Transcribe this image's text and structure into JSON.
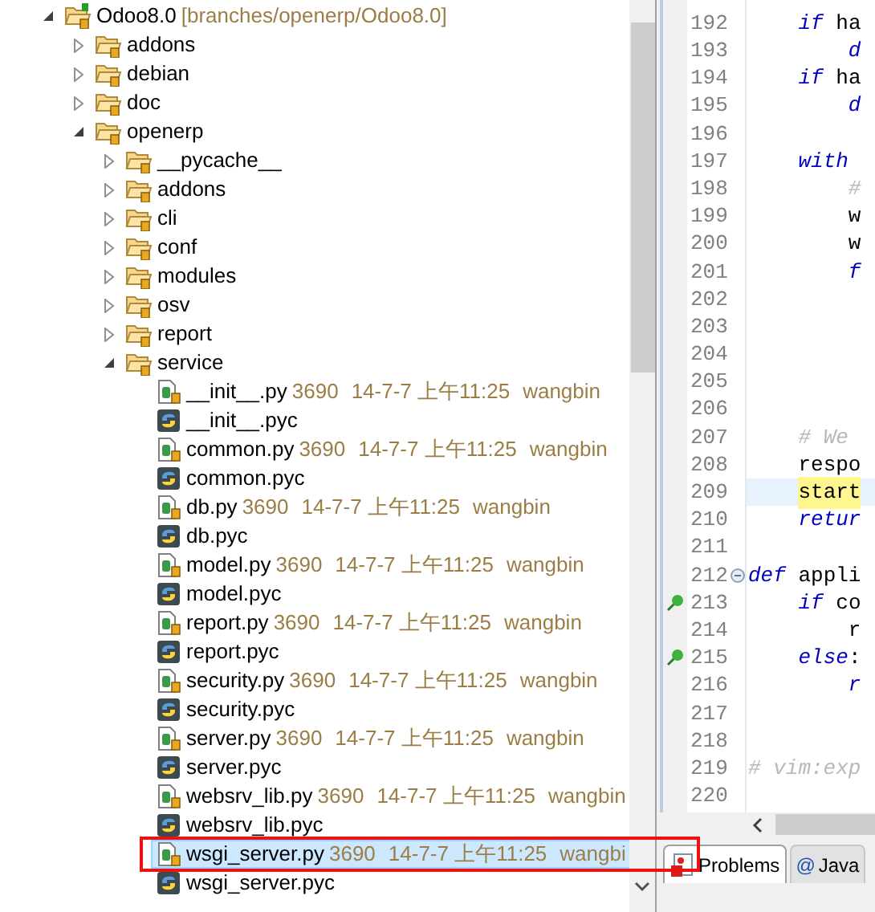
{
  "tree": {
    "name": "Odoo8.0",
    "decoration": "[branches/openerp/Odoo8.0]",
    "kind": "project",
    "expanded": true,
    "selected": false,
    "children": [
      {
        "kind": "folder",
        "name": "addons",
        "expanded": false,
        "selected": false
      },
      {
        "kind": "folder",
        "name": "debian",
        "expanded": false,
        "selected": false
      },
      {
        "kind": "folder",
        "name": "doc",
        "expanded": false,
        "selected": false
      },
      {
        "kind": "folder",
        "name": "openerp",
        "expanded": true,
        "selected": false,
        "children": [
          {
            "kind": "folder",
            "name": "__pycache__",
            "expanded": false,
            "selected": false
          },
          {
            "kind": "folder",
            "name": "addons",
            "expanded": false,
            "selected": false
          },
          {
            "kind": "folder",
            "name": "cli",
            "expanded": false,
            "selected": false
          },
          {
            "kind": "folder",
            "name": "conf",
            "expanded": false,
            "selected": false
          },
          {
            "kind": "folder",
            "name": "modules",
            "expanded": false,
            "selected": false
          },
          {
            "kind": "folder",
            "name": "osv",
            "expanded": false,
            "selected": false
          },
          {
            "kind": "folder",
            "name": "report",
            "expanded": false,
            "selected": false
          },
          {
            "kind": "folder",
            "name": "service",
            "expanded": true,
            "selected": false,
            "children": [
              {
                "kind": "py",
                "name": "__init__.py",
                "revision": "3690",
                "date": "14-7-7 上午11:25",
                "author": "wangbin",
                "selected": false
              },
              {
                "kind": "pyc",
                "name": "__init__.pyc",
                "selected": false
              },
              {
                "kind": "py",
                "name": "common.py",
                "revision": "3690",
                "date": "14-7-7 上午11:25",
                "author": "wangbin",
                "selected": false
              },
              {
                "kind": "pyc",
                "name": "common.pyc",
                "selected": false
              },
              {
                "kind": "py",
                "name": "db.py",
                "revision": "3690",
                "date": "14-7-7 上午11:25",
                "author": "wangbin",
                "selected": false
              },
              {
                "kind": "pyc",
                "name": "db.pyc",
                "selected": false
              },
              {
                "kind": "py",
                "name": "model.py",
                "revision": "3690",
                "date": "14-7-7 上午11:25",
                "author": "wangbin",
                "selected": false
              },
              {
                "kind": "pyc",
                "name": "model.pyc",
                "selected": false
              },
              {
                "kind": "py",
                "name": "report.py",
                "revision": "3690",
                "date": "14-7-7 上午11:25",
                "author": "wangbin",
                "selected": false
              },
              {
                "kind": "pyc",
                "name": "report.pyc",
                "selected": false
              },
              {
                "kind": "py",
                "name": "security.py",
                "revision": "3690",
                "date": "14-7-7 上午11:25",
                "author": "wangbin",
                "selected": false
              },
              {
                "kind": "pyc",
                "name": "security.pyc",
                "selected": false
              },
              {
                "kind": "py",
                "name": "server.py",
                "revision": "3690",
                "date": "14-7-7 上午11:25",
                "author": "wangbin",
                "selected": false
              },
              {
                "kind": "pyc",
                "name": "server.pyc",
                "selected": false
              },
              {
                "kind": "py",
                "name": "websrv_lib.py",
                "revision": "3690",
                "date": "14-7-7 上午11:25",
                "author": "wangbin",
                "selected": false
              },
              {
                "kind": "pyc",
                "name": "websrv_lib.pyc",
                "selected": false
              },
              {
                "kind": "py",
                "name": "wsgi_server.py",
                "revision": "3690",
                "date": "14-7-7 上午11:25",
                "author": "wangbi",
                "selected": true
              },
              {
                "kind": "pyc",
                "name": "wsgi_server.pyc",
                "selected": false
              }
            ]
          }
        ]
      }
    ]
  },
  "annotation_box": true,
  "editor": {
    "lines": [
      {
        "number": "192",
        "tokens": [
          {
            "kind": "keyword",
            "text": "    if"
          },
          {
            "kind": "plain",
            "text": " ha"
          }
        ]
      },
      {
        "number": "193",
        "tokens": [
          {
            "kind": "keyword",
            "text": "        d"
          }
        ]
      },
      {
        "number": "194",
        "tokens": [
          {
            "kind": "keyword",
            "text": "    if"
          },
          {
            "kind": "plain",
            "text": " ha"
          }
        ]
      },
      {
        "number": "195",
        "tokens": [
          {
            "kind": "keyword",
            "text": "        d"
          }
        ]
      },
      {
        "number": "196"
      },
      {
        "number": "197",
        "tokens": [
          {
            "kind": "keyword",
            "text": "    with"
          }
        ]
      },
      {
        "number": "198",
        "tokens": [
          {
            "kind": "comment",
            "text": "        #"
          }
        ]
      },
      {
        "number": "199",
        "tokens": [
          {
            "kind": "plain",
            "text": "        w"
          }
        ]
      },
      {
        "number": "200",
        "tokens": [
          {
            "kind": "plain",
            "text": "        w"
          }
        ]
      },
      {
        "number": "201",
        "tokens": [
          {
            "kind": "keyword",
            "text": "        f"
          }
        ]
      },
      {
        "number": "202"
      },
      {
        "number": "203"
      },
      {
        "number": "204"
      },
      {
        "number": "205"
      },
      {
        "number": "206"
      },
      {
        "number": "207",
        "tokens": [
          {
            "kind": "comment",
            "text": "    # We"
          }
        ]
      },
      {
        "number": "208",
        "tokens": [
          {
            "kind": "plain",
            "text": "    respo"
          }
        ]
      },
      {
        "number": "209",
        "current": true,
        "tokens": [
          {
            "kind": "occurrence",
            "text": "    start"
          }
        ]
      },
      {
        "number": "210",
        "tokens": [
          {
            "kind": "keyword",
            "text": "    retur"
          }
        ]
      },
      {
        "number": "211"
      },
      {
        "number": "212",
        "fold": true,
        "tokens": [
          {
            "kind": "keyword",
            "text": "def"
          },
          {
            "kind": "plain",
            "text": " appli"
          }
        ]
      },
      {
        "number": "213",
        "breakpoint": true,
        "tokens": [
          {
            "kind": "keyword",
            "text": "    if"
          },
          {
            "kind": "plain",
            "text": " co"
          }
        ]
      },
      {
        "number": "214",
        "tokens": [
          {
            "kind": "plain",
            "text": "        r"
          }
        ]
      },
      {
        "number": "215",
        "breakpoint": true,
        "tokens": [
          {
            "kind": "keyword",
            "text": "    else"
          },
          {
            "kind": "plain",
            "text": ":"
          }
        ]
      },
      {
        "number": "216",
        "tokens": [
          {
            "kind": "keyword",
            "text": "        r"
          }
        ]
      },
      {
        "number": "217"
      },
      {
        "number": "218"
      },
      {
        "number": "219",
        "tokens": [
          {
            "kind": "comment",
            "text": "# vim:exp"
          }
        ]
      },
      {
        "number": "220"
      }
    ]
  },
  "bottom_tabs": [
    {
      "kind": "problems",
      "label": "Problems",
      "selected": true
    },
    {
      "kind": "javadoc",
      "icon": "@",
      "label": "Java",
      "selected": false
    }
  ]
}
